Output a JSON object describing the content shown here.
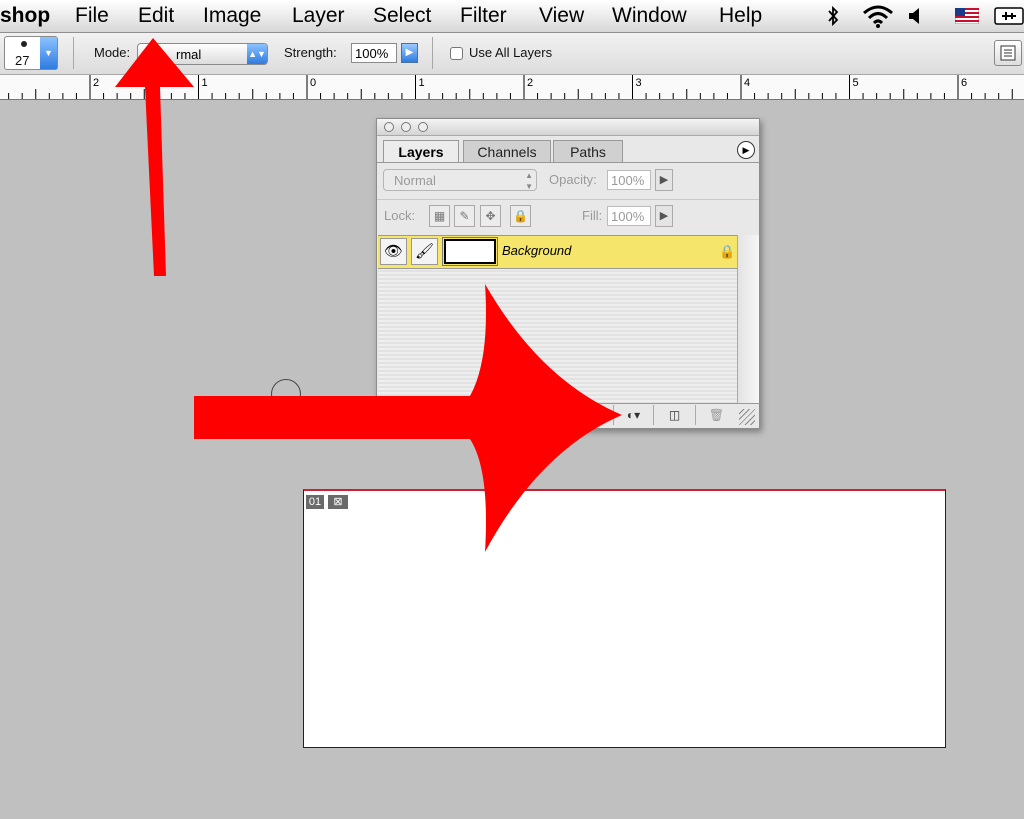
{
  "menubar": {
    "app": "shop",
    "items": [
      "File",
      "Edit",
      "Image",
      "Layer",
      "Select",
      "Filter",
      "View",
      "Window",
      "Help"
    ],
    "status_icons": [
      "bluetooth-icon",
      "wifi-icon",
      "volume-icon",
      "us-flag-icon",
      "battery-icon"
    ]
  },
  "options": {
    "brush_size": "27",
    "mode_label": "Mode:",
    "mode_value": "rmal",
    "strength_label": "Strength:",
    "strength_value": "100%",
    "use_all_layers": "Use All Layers"
  },
  "ruler": {
    "labels": [
      "2",
      "1",
      "0",
      "1",
      "2",
      "3",
      "4",
      "5",
      "6"
    ]
  },
  "layers_panel": {
    "tabs": [
      "Layers",
      "Channels",
      "Paths"
    ],
    "blend_mode": "Normal",
    "opacity_label": "Opacity:",
    "opacity_value": "100%",
    "lock_label": "Lock:",
    "fill_label": "Fill:",
    "fill_value": "100%",
    "layer_name": "Background",
    "layer_highlight": "#f5e66b"
  },
  "document": {
    "tag": "01"
  },
  "colors": {
    "arrow": "#ff0000"
  }
}
